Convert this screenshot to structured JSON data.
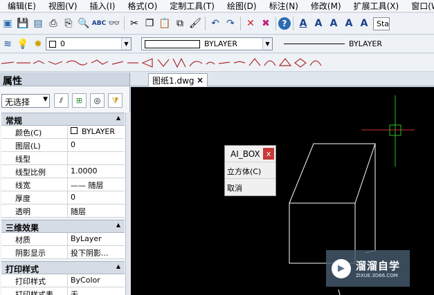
{
  "menu": [
    {
      "label": "编辑(E)"
    },
    {
      "label": "视图(V)"
    },
    {
      "label": "插入(I)"
    },
    {
      "label": "格式(O)"
    },
    {
      "label": "定制工具(T)"
    },
    {
      "label": "绘图(D)"
    },
    {
      "label": "标注(N)"
    },
    {
      "label": "修改(M)"
    },
    {
      "label": "扩展工具(X)"
    },
    {
      "label": "窗口(W)"
    }
  ],
  "toolbar1": {
    "icons": [
      "new-file-icon",
      "save-icon",
      "print-icon",
      "print-preview-icon",
      "find-icon",
      "spellcheck-icon",
      "binoculars-icon",
      "cut-icon",
      "copy-icon",
      "paste-icon",
      "match-properties-icon",
      "undo-icon",
      "redo-icon",
      "erase-icon",
      "purge-icon",
      "help-icon",
      "text-style-icon",
      "text-icon",
      "edit-text-icon",
      "text-find-icon",
      "text-format-icon"
    ],
    "spellcheck_label": "ABC",
    "style_combo_value": "Sta"
  },
  "toolbar2": {
    "layer_value": "0",
    "color_value": "BYLAYER",
    "linetype_value": "BYLAYER"
  },
  "properties": {
    "title": "属性",
    "selection": "无选择",
    "sections": [
      {
        "title": "常规",
        "rows": [
          {
            "key": "颜色(C)",
            "value": "BYLAYER"
          },
          {
            "key": "图层(L)",
            "value": "0"
          },
          {
            "key": "线型",
            "value": ""
          },
          {
            "key": "线型比例",
            "value": "1.0000"
          },
          {
            "key": "线宽",
            "value": "—— 随层"
          },
          {
            "key": "厚度",
            "value": "0"
          },
          {
            "key": "透明",
            "value": "随层"
          }
        ]
      },
      {
        "title": "三维效果",
        "rows": [
          {
            "key": "材质",
            "value": "ByLayer"
          },
          {
            "key": "阴影显示",
            "value": "投下阴影..."
          }
        ]
      },
      {
        "title": "打印样式",
        "rows": [
          {
            "key": "打印样式",
            "value": "ByColor"
          },
          {
            "key": "打印样式表",
            "value": "无"
          }
        ]
      }
    ]
  },
  "document": {
    "tab_label": "图纸1.dwg",
    "tab_close": "×"
  },
  "popup": {
    "title": "AI_BOX",
    "close": "x",
    "options": [
      "立方体(C)",
      "取消"
    ]
  },
  "watermark": {
    "name": "溜溜自学",
    "url": "ZIXUE.3D66.COM"
  },
  "colors": {
    "canvas_bg": "#000000",
    "crosshair_h": "#d03030",
    "crosshair_v": "#28c028",
    "popup_close": "#c73a3a",
    "box_lines": "#ffffff"
  }
}
